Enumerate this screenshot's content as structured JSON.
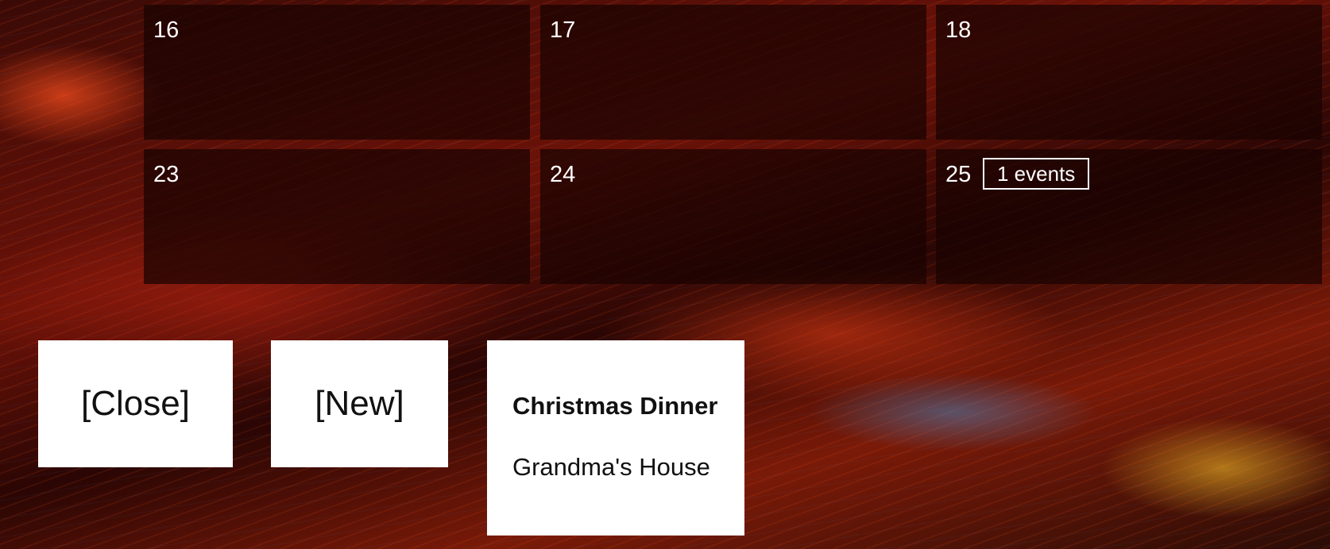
{
  "calendar": {
    "rows": [
      {
        "days": [
          {
            "number": "16",
            "events_label": null
          },
          {
            "number": "17",
            "events_label": null
          },
          {
            "number": "18",
            "events_label": null
          }
        ]
      },
      {
        "days": [
          {
            "number": "23",
            "events_label": null
          },
          {
            "number": "24",
            "events_label": null
          },
          {
            "number": "25",
            "events_label": "1 events"
          }
        ]
      }
    ]
  },
  "actions": {
    "close_label": "[Close]",
    "new_label": "[New]"
  },
  "event": {
    "title": "Christmas Dinner",
    "location": "Grandma's House"
  }
}
